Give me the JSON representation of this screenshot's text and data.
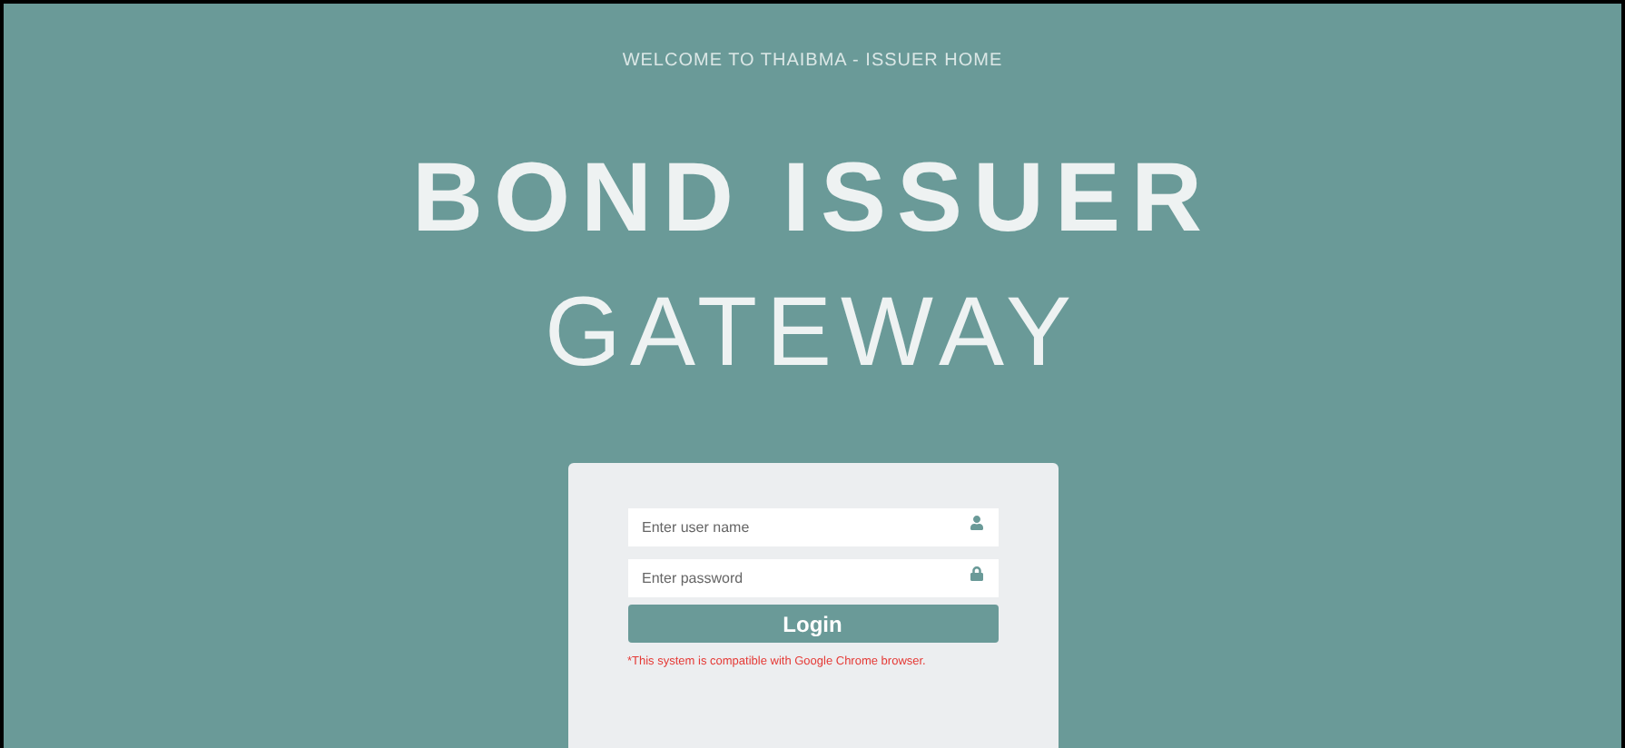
{
  "header": {
    "welcome": "WELCOME TO THAIBMA - ISSUER HOME"
  },
  "title": {
    "line_1": "BOND ISSUER",
    "line_2": "GATEWAY"
  },
  "login_form": {
    "username": {
      "placeholder": "Enter user name"
    },
    "password": {
      "placeholder": "Enter password"
    },
    "button": "Login",
    "notice": "*This system is compatible with Google Chrome browser."
  }
}
